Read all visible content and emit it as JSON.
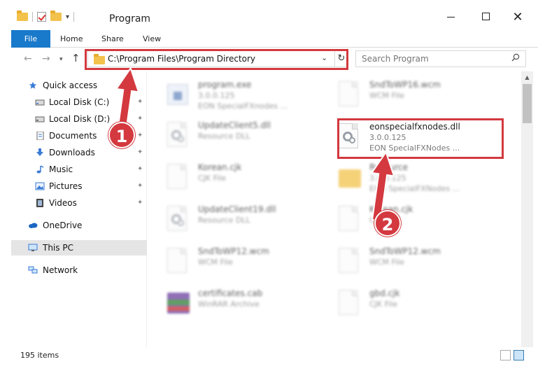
{
  "window": {
    "title": "Program",
    "minimize_glyph": "",
    "close_glyph": "✕"
  },
  "ribbon": {
    "tabs": [
      "File",
      "Home",
      "Share",
      "View"
    ]
  },
  "address": {
    "path": "C:\\Program Files\\Program Directory",
    "refresh_glyph": "↻",
    "dropdown_glyph": "⌄"
  },
  "search": {
    "placeholder": "Search Program"
  },
  "sidebar": {
    "items": [
      {
        "label": "Quick access",
        "pinned": false
      },
      {
        "label": "Local Disk (C:)",
        "pinned": true
      },
      {
        "label": "Local Disk (D:)",
        "pinned": true
      },
      {
        "label": "Documents",
        "pinned": true
      },
      {
        "label": "Downloads",
        "pinned": true
      },
      {
        "label": "Music",
        "pinned": true
      },
      {
        "label": "Pictures",
        "pinned": true
      },
      {
        "label": "Videos",
        "pinned": true
      },
      {
        "label": "OneDrive",
        "pinned": false
      },
      {
        "label": "This PC",
        "pinned": false
      },
      {
        "label": "Network",
        "pinned": false
      }
    ],
    "pin_glyph": "📌"
  },
  "files": {
    "left": [
      {
        "name": "program.exe",
        "line2": "3.0.0.125",
        "line3": "EON SpecialFXnodes ..."
      },
      {
        "name": "UpdateClient5.dll",
        "line2": "Resource DLL",
        "line3": ""
      },
      {
        "name": "Korean.cjk",
        "line2": "CJK File",
        "line3": ""
      },
      {
        "name": "UpdateClient19.dll",
        "line2": "Resource DLL",
        "line3": ""
      },
      {
        "name": "SndToWP12.wcm",
        "line2": "WCM File",
        "line3": ""
      },
      {
        "name": "certificates.cab",
        "line2": "WinRAR Archive",
        "line3": ""
      }
    ],
    "right": [
      {
        "name": "SndToWP16.wcm",
        "line2": "WCM File",
        "line3": ""
      },
      {
        "name": "eonspecialfxnodes.dll",
        "line2": "3.0.0.125",
        "line3": "EON SpecialFXNodes ..."
      },
      {
        "name": "Resource",
        "line2": "3.0.0.125",
        "line3": "EON SpecialFXNodes ..."
      },
      {
        "name": "Korean.cjk",
        "line2": "CJK File",
        "line3": ""
      },
      {
        "name": "SndToWP12.wcm",
        "line2": "WCM File",
        "line3": ""
      },
      {
        "name": "gbd.cjk",
        "line2": "CJK File",
        "line3": ""
      }
    ]
  },
  "status": {
    "item_count": "195 items"
  },
  "annotations": {
    "step1": "1",
    "step2": "2"
  },
  "colors": {
    "accent": "#1979ca",
    "highlight": "#d3393f",
    "folder": "#f2c24c"
  }
}
